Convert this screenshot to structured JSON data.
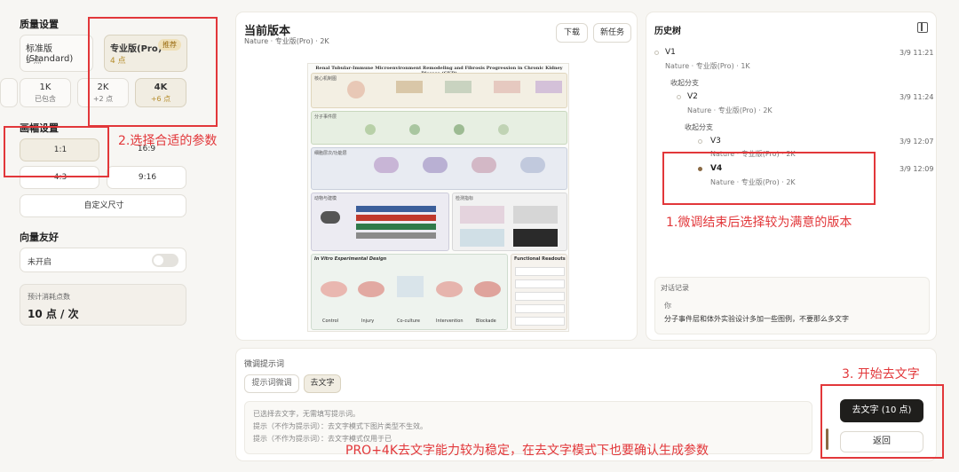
{
  "sidebar": {
    "quality_title": "质量设置",
    "quality_options": [
      {
        "title": "标准版(Standard)",
        "sub": "3 点"
      },
      {
        "title": "专业版(Pro)",
        "sub": "4 点",
        "badge": "推荐"
      }
    ],
    "resolution_options": [
      {
        "title": "1K",
        "sub": "已包含"
      },
      {
        "title": "2K",
        "sub": "+2 点"
      },
      {
        "title": "4K",
        "sub": "+6 点"
      }
    ],
    "aspect_title": "画幅设置",
    "aspect_options": [
      "1:1",
      "16:9",
      "4:3",
      "9:16"
    ],
    "custom_size_label": "自定义尺寸",
    "friendly_title": "向量友好",
    "toggle_label": "未开启",
    "cost_label": "预计消耗点数",
    "cost_value": "10 点 / 次"
  },
  "main": {
    "title": "当前版本",
    "subtitle": "Nature · 专业版(Pro) · 2K",
    "download_label": "下载",
    "new_task_label": "新任务",
    "figure": {
      "title": "Renal Tubular-Immune Microenvironment Remodeling and Fibrosis Progression in Chronic Kidney Disease (CKD)",
      "sec1": "核心机制图",
      "sec2": "分子事件层",
      "sec3": "细胞层次/功能层",
      "sec4": "动物与建模",
      "sec4b": "检测指标",
      "sec5": "In Vitro Experimental Design",
      "sec5b": "Functional Readouts",
      "invitro_labels": [
        "Control",
        "Injury",
        "Co-culture",
        "Intervention",
        "Blockade"
      ]
    }
  },
  "history": {
    "title": "历史树",
    "nodes": [
      {
        "label": "V1",
        "sub": "Nature · 专业版(Pro) · 1K",
        "time": "3/9 11:21"
      },
      {
        "label": "V2",
        "sub": "Nature · 专业版(Pro) · 2K",
        "time": "3/9 11:24"
      },
      {
        "label": "V3",
        "sub": "Nature · 专业版(Pro) · 2K",
        "time": "3/9 12:07"
      },
      {
        "label": "V4",
        "sub": "Nature · 专业版(Pro) · 2K",
        "time": "3/9 12:09"
      }
    ],
    "collapse_label": "收起分支",
    "dialog_title": "对话记录",
    "dialog_speaker": "你",
    "dialog_message": "分子事件层和体外实验设计多加一些图例，不要那么多文字"
  },
  "bottom": {
    "label": "微调提示词",
    "tabs": [
      "提示词微调",
      "去文字"
    ],
    "info_lines": [
      "已选择去文字，无需填写提示词。",
      "提示（不作为提示词）：去文字模式下图片类型不生效。",
      "提示（不作为提示词）：去文字模式仅用于已"
    ],
    "action_label": "去文字 (10 点)",
    "back_label": "返回"
  },
  "annotations": {
    "a1": "1.微调结束后选择较为满意的版本",
    "a2": "2.选择合适的参数",
    "a3": "3. 开始去文字",
    "a4": "PRO+4K去文字能力较为稳定，在去文字模式下也要确认生成参数"
  },
  "colors": {
    "accent": "#1f1e1c",
    "annotation": "#e2373a",
    "gold": "#b58d2c"
  }
}
